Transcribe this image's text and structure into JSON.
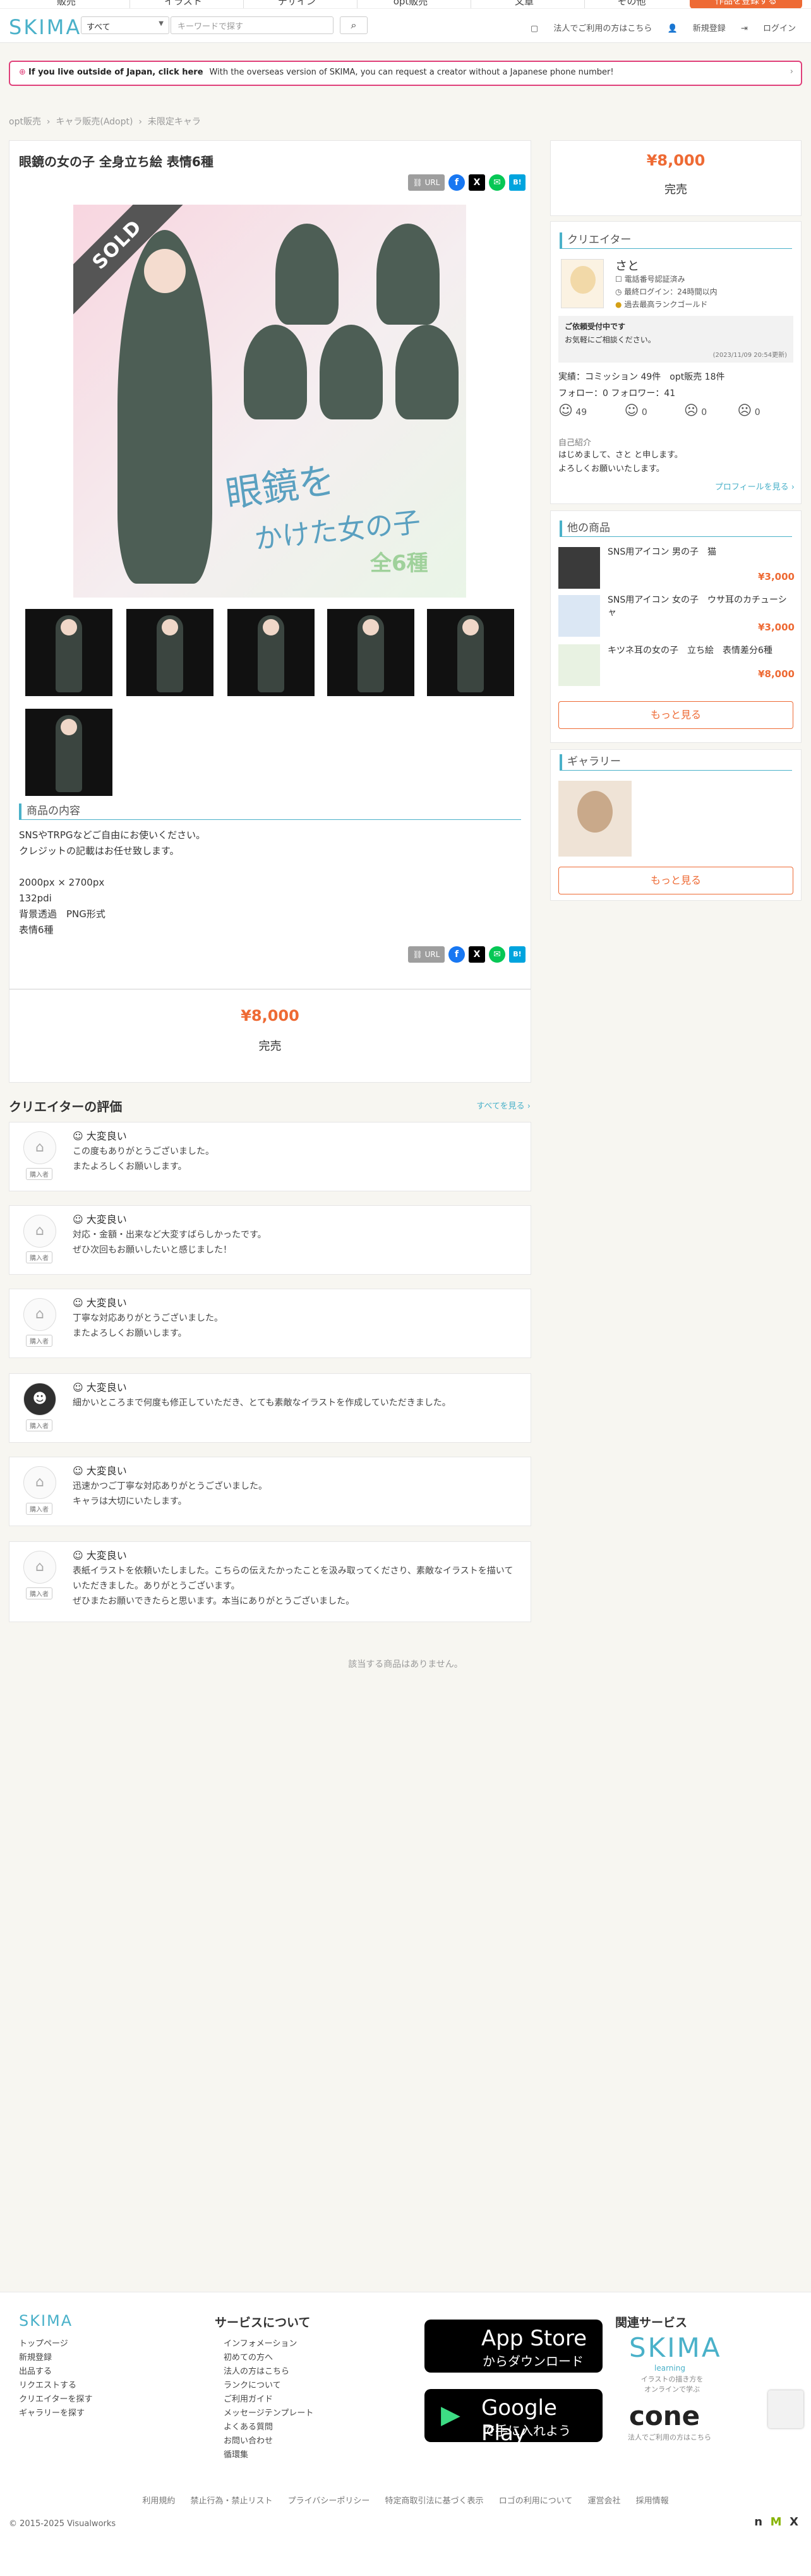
{
  "nav": {
    "tabs": [
      "販売",
      "イラスト",
      "デザイン",
      "opt販売",
      "文章",
      "その他"
    ],
    "cta": "作品を登録する"
  },
  "header": {
    "logo": "SKIMA",
    "category": "すべて",
    "search_placeholder": "キーワードで探す",
    "links": [
      "法人でご利用の方はこちら",
      "新規登録",
      "ログイン"
    ]
  },
  "banner": {
    "strong": "If you live outside of Japan, click here",
    "text": "With the overseas version of SKIMA, you can request a creator without a Japanese phone number!"
  },
  "breadcrumb": [
    "opt販売",
    "キャラ販売(Adopt)",
    "未限定キャラ"
  ],
  "product": {
    "title": "眼鏡の女の子 全身立ち絵 表情6種",
    "url_label": "URL",
    "sold": "SOLD",
    "image_text1": "眼鏡を",
    "image_text2": "かけた女の子",
    "image_text3": "全6種",
    "section_title": "商品の内容",
    "description": [
      "SNSやTRPGなどご自由にお使いください。",
      "クレジットの記載はお任せ致します。",
      "",
      "2000px × 2700px",
      "132pdi",
      "背景透過　PNG形式",
      "表情6種"
    ],
    "price": "¥8,000",
    "status": "完売"
  },
  "sidebar": {
    "price": "¥8,000",
    "status": "完売",
    "creator_title": "クリエイター",
    "creator_name": "さと",
    "creator_badges": [
      "電話番号認証済み",
      "最終ログイン：24時間以内",
      "過去最高ランクゴールド"
    ],
    "notice_title": "ご依頼受付中です",
    "notice_text": "お気軽にご相談ください。",
    "notice_date": "(2023/11/09 20:54更新)",
    "stats": "実績：コミッション 49件　opt販売 18件",
    "follow": "フォロー：0  フォロワー：41",
    "ratings": [
      "49",
      "0",
      "0",
      "0"
    ],
    "intro_title": "自己紹介",
    "intro": "はじめまして、さと と申します。\nよろしくお願いいたします。",
    "profile_link": "プロフィールを見る ›",
    "other_title": "他の商品",
    "items": [
      {
        "name": "SNS用アイコン 男の子　猫",
        "price": "¥3,000"
      },
      {
        "name": "SNS用アイコン 女の子　ウサ耳のカチューシャ",
        "price": "¥3,000"
      },
      {
        "name": "キツネ耳の女の子　立ち絵　表情差分6種",
        "price": "¥8,000"
      }
    ],
    "more": "もっと見る",
    "gallery_title": "ギャラリー",
    "gallery_more": "もっと見る"
  },
  "reviews": {
    "title": "クリエイターの評価",
    "see_all": "すべてを見る ›",
    "tag": "購入者",
    "items": [
      {
        "rating": "大変良い",
        "text": "この度もありがとうございました。\nまたよろしくお願いします。"
      },
      {
        "rating": "大変良い",
        "text": "対応・金額・出来など大変すばらしかったです。\nぜひ次回もお願いしたいと感じました！"
      },
      {
        "rating": "大変良い",
        "text": "丁寧な対応ありがとうございました。\nまたよろしくお願いします。"
      },
      {
        "rating": "大変良い",
        "text": "細かいところまで何度も修正していただき、とても素敵なイラストを作成していただきました。"
      },
      {
        "rating": "大変良い",
        "text": "迅速かつご丁寧な対応ありがとうございました。\nキャラは大切にいたします。"
      },
      {
        "rating": "大変良い",
        "text": "表紙イラストを依頼いたしました。こちらの伝えたかったことを汲み取ってくださり、素敵なイラストを描いていただきました。ありがとうございます。\nぜひまたお願いできたらと思います。本当にありがとうございました。"
      }
    ],
    "empty": "該当する商品はありません。"
  },
  "footer": {
    "logo": "SKIMA",
    "left_links": [
      "トップページ",
      "新規登録",
      "出品する",
      "リクエストする",
      "クリエイターを探す",
      "ギャラリーを探す"
    ],
    "service_title": "サービスについて",
    "service_links": [
      "インフォメーション",
      "初めての方へ",
      "法人の方はこちら",
      "ランクについて",
      "ご利用ガイド",
      "メッセージテンプレート",
      "よくある質問",
      "お問い合わせ",
      "循環集"
    ],
    "appstore_big": "App Store",
    "appstore_small": "からダウンロード",
    "gplay_big": "Google Play",
    "gplay_small": "で手に入れよう",
    "related_title": "関連サービス",
    "skima_learning": "SKIMA",
    "learning_sub": "learning",
    "learning_text": "イラストの描き方を\nオンラインで学ぶ",
    "cone": "cone",
    "cone_text": "法人でご利用の方はこちら",
    "bottom_links": [
      "利用規約",
      "禁止行為・禁止リスト",
      "プライバシーポリシー",
      "特定商取引法に基づく表示",
      "ロゴの利用について",
      "運営会社",
      "採用情報"
    ],
    "copyright": "© 2015-2025 Visualworks"
  }
}
